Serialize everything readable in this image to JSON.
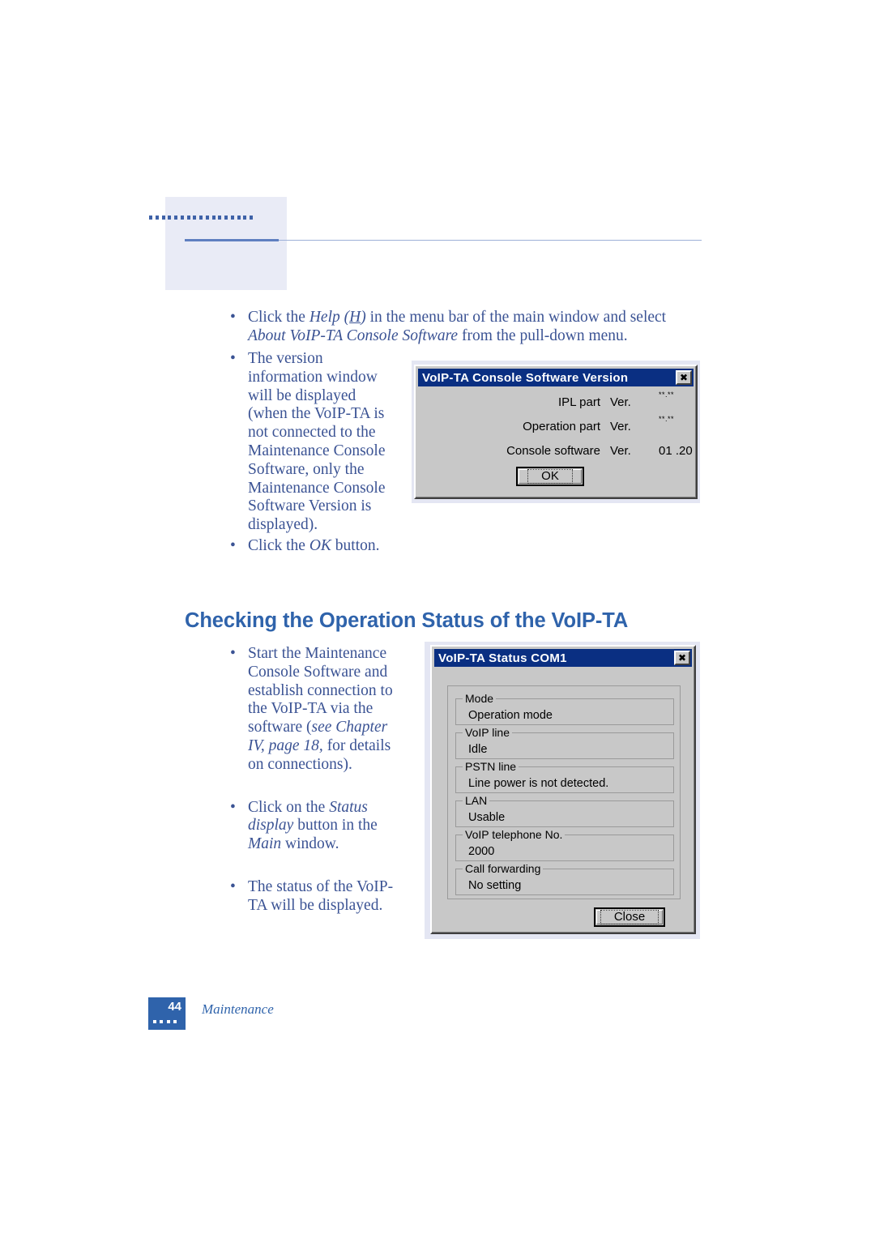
{
  "page": {
    "number": "44",
    "footer_label": "Maintenance",
    "accent_color": "#2f63ab",
    "body_text_color": "#3b5394",
    "header_box_color": "#e9ebf6"
  },
  "header": {
    "dot_count": 17,
    "rule_name": "header-rule"
  },
  "steps_version": {
    "intro": {
      "bullet": "•",
      "line1_a": "Click the ",
      "line1_help": "Help (",
      "line1_h": "H",
      "line1_help_close": ")",
      "line1_b": " in the menu bar of the main window and select",
      "line2_title": "About VoIP-TA Console Software",
      "line2_b": " from the pull-down menu."
    },
    "version_window": {
      "bullet": "•",
      "text": "The version information window will be displayed (when the VoIP-TA is not connected to the Maintenance Console Software, only the Maintenance Console Software Version is displayed)."
    },
    "click_ok": {
      "bullet": "•",
      "a": " Click the ",
      "em": "OK",
      "b": " button."
    }
  },
  "dialog_version": {
    "title": "VoIP-TA Console Software Version",
    "close_icon": "✖",
    "rows": [
      {
        "label": "IPL part",
        "ver": "Ver.",
        "value": "**.**",
        "small": true
      },
      {
        "label": "Operation part",
        "ver": "Ver.",
        "value": "**.**",
        "small": true
      },
      {
        "label": "Console software",
        "ver": "Ver.",
        "value": "01 .20",
        "small": false
      }
    ],
    "ok_button": "OK"
  },
  "section": {
    "heading": "Checking the Operation Status of the VoIP-TA"
  },
  "steps_status": {
    "start": {
      "bullet": "•",
      "a": "Start the Maintenance Console Software and establish connection to the VoIP-TA via the software (",
      "em1": "see Chapter IV,",
      "em2": "page 18,",
      "b": " for details on connections)."
    },
    "click_status": {
      "bullet": "•",
      "a": "Click on the ",
      "em1": "Status",
      "em2": "display",
      "b": " button in the ",
      "em3": "Main",
      "c": " window."
    },
    "displayed": {
      "bullet": "•",
      "text": "The status of the VoIP-TA will be displayed."
    }
  },
  "dialog_status": {
    "title": "VoIP-TA Status  COM1",
    "close_icon": "✖",
    "groups": [
      {
        "legend": "Mode",
        "value": "Operation mode"
      },
      {
        "legend": "VoIP line",
        "value": "Idle"
      },
      {
        "legend": "PSTN line",
        "value": "Line power is not detected."
      },
      {
        "legend": "LAN",
        "value": "Usable"
      },
      {
        "legend": "VoIP telephone No.",
        "value": "2000"
      },
      {
        "legend": "Call forwarding",
        "value": "No setting"
      }
    ],
    "close_button": "Close"
  }
}
